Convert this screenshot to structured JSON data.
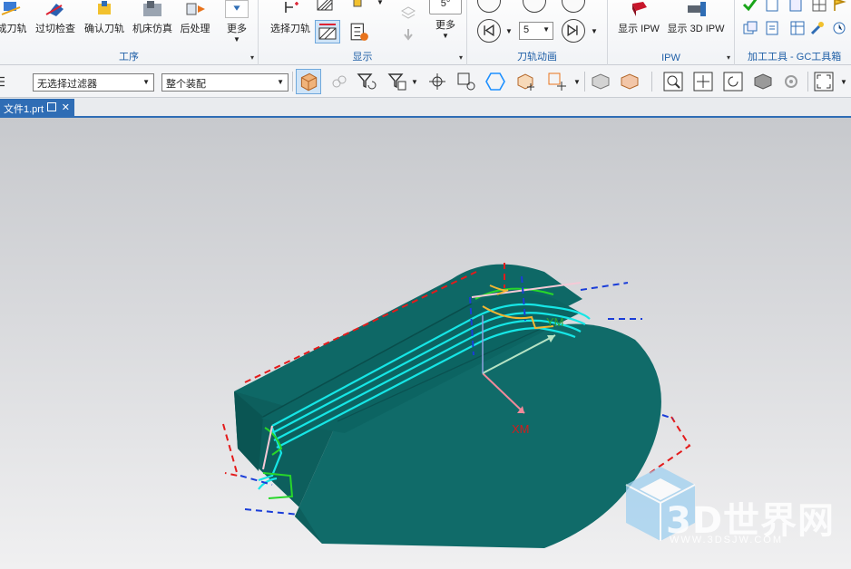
{
  "ribbon": {
    "operation_group": {
      "label": "工序",
      "buttons": [
        {
          "label": "成刀轨",
          "icon": "generate-toolpath-icon"
        },
        {
          "label": "过切检查",
          "icon": "gouge-check-icon"
        },
        {
          "label": "确认刀轨",
          "icon": "verify-toolpath-icon"
        },
        {
          "label": "机床仿真",
          "icon": "machine-simulation-icon"
        },
        {
          "label": "后处理",
          "icon": "postprocess-icon"
        },
        {
          "label": "更多",
          "icon": "more-icon"
        }
      ]
    },
    "display_group": {
      "label": "显示",
      "select_toolpath_label": "选择刀轨",
      "more_label": "更多",
      "angle_value": "5°"
    },
    "animation_group": {
      "label": "刀轨动画",
      "speed_value": "5"
    },
    "ipw_group": {
      "label": "IPW",
      "show_ipw_label": "显示 IPW",
      "show_3d_ipw_label": "显示 3D IPW"
    },
    "tools_group": {
      "label": "加工工具 - GC工具箱"
    }
  },
  "selection_bar": {
    "filter_value": "无选择过滤器",
    "scope_value": "整个装配"
  },
  "document_tab": {
    "label": "文件1.prt"
  },
  "viewport": {
    "axis_x_label": "XM",
    "axis_y_label": "YM",
    "model_color": "#0f6e6c",
    "toolpath_color": "#16e6e6"
  },
  "watermark": {
    "brand": "3D世界网",
    "url": "WWW.3DSJW.COM"
  }
}
